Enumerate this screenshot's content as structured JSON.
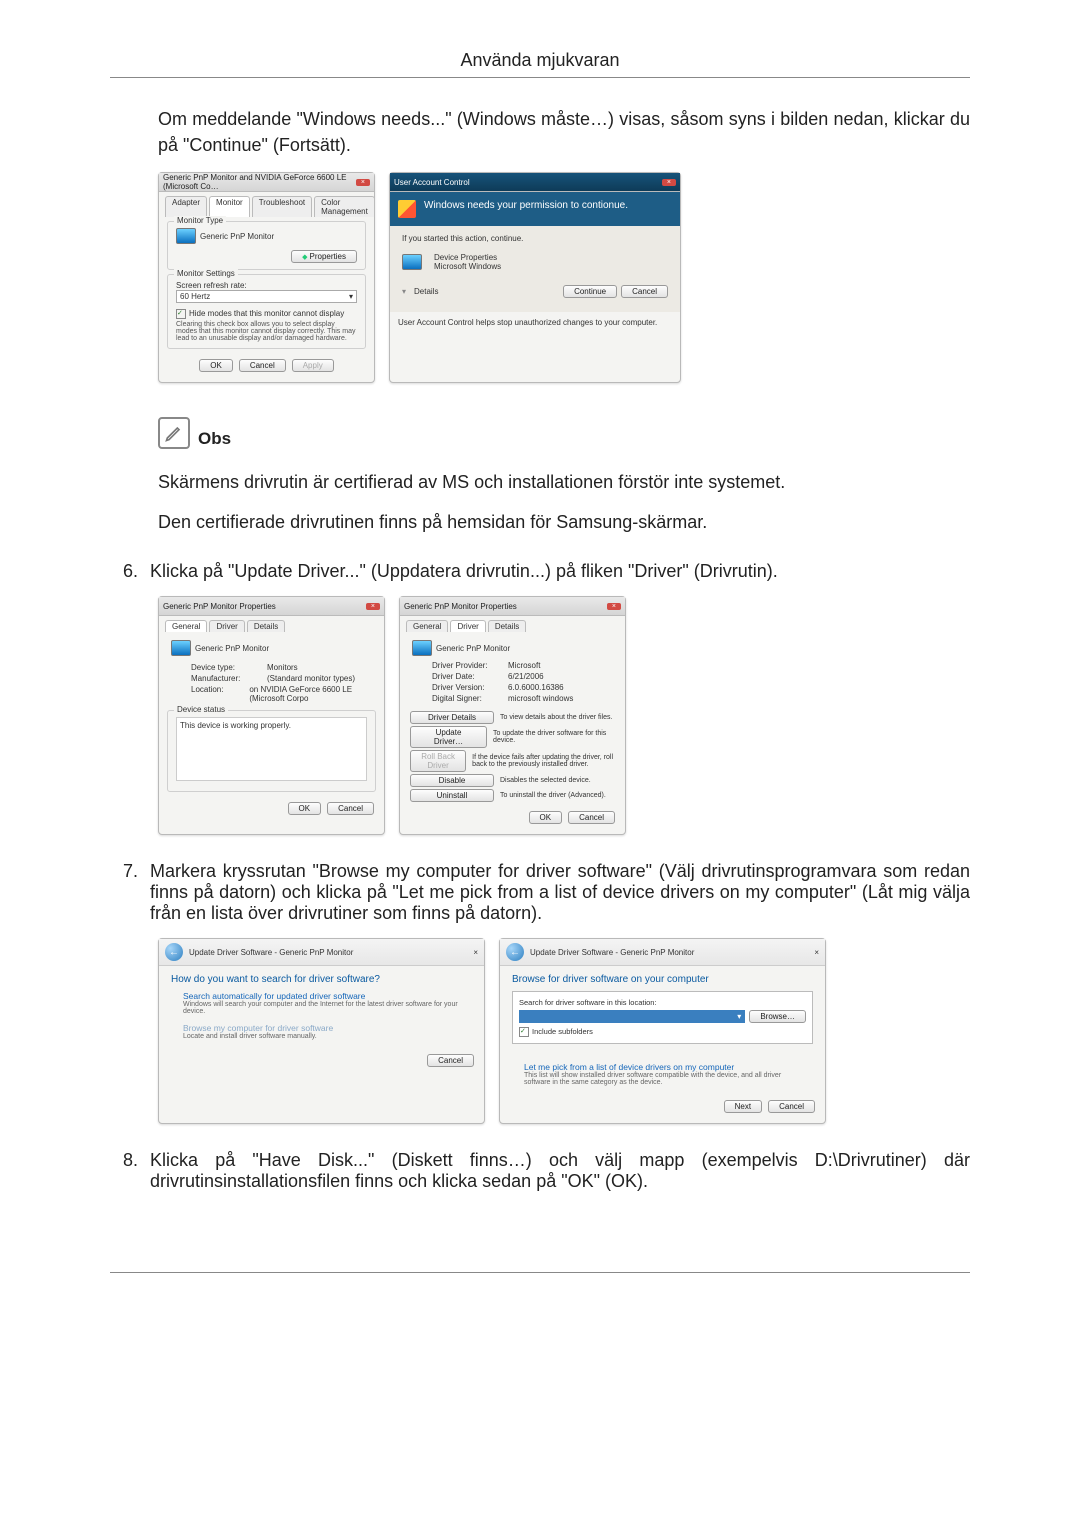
{
  "section_title": "Använda mjukvaran",
  "intro": "Om meddelande \"Windows needs...\" (Windows måste…) visas, såsom syns i bilden nedan, klickar du på \"Continue\" (Fortsätt).",
  "note_label": "Obs",
  "note_p1": "Skärmens drivrutin är certifierad av MS och installationen förstör inte systemet.",
  "note_p2": "Den certifierade drivrutinen finns på hemsidan för Samsung-skärmar.",
  "step6_num": "6.",
  "step6": "Klicka på \"Update Driver...\" (Uppdatera drivrutin...) på fliken \"Driver\" (Drivrutin).",
  "step7_num": "7.",
  "step7": "Markera kryssrutan \"Browse my computer for driver software\" (Välj drivrutinsprogramvara som redan finns på datorn) och klicka på \"Let me pick from a list of device drivers on my computer\" (Låt mig välja från en lista över drivrutiner som finns på datorn).",
  "step8_num": "8.",
  "step8": "Klicka på \"Have Disk...\" (Diskett finns…) och välj mapp (exempelvis D:\\Drivrutiner) där drivrutinsinstallationsfilen finns och klicka sedan på \"OK\" (OK).",
  "dlg1": {
    "title": "Generic PnP Monitor and NVIDIA GeForce 6600 LE (Microsoft Co…",
    "tabs": {
      "adapter": "Adapter",
      "monitor": "Monitor",
      "troubleshoot": "Troubleshoot",
      "color": "Color Management"
    },
    "monitor_type": "Monitor Type",
    "monitor_name": "Generic PnP Monitor",
    "properties": "Properties",
    "monitor_settings": "Monitor Settings",
    "refresh_label": "Screen refresh rate:",
    "refresh_value": "60 Hertz",
    "hide_cb": "Hide modes that this monitor cannot display",
    "hide_desc": "Clearing this check box allows you to select display modes that this monitor cannot display correctly. This may lead to an unusable display and/or damaged hardware.",
    "ok": "OK",
    "cancel": "Cancel",
    "apply": "Apply"
  },
  "uac": {
    "title": "User Account Control",
    "headline": "Windows needs your permission to contionue.",
    "if_started": "If you started this action, continue.",
    "prop": "Device Properties",
    "vendor": "Microsoft Windows",
    "details": "Details",
    "continue": "Continue",
    "cancel": "Cancel",
    "footer": "User Account Control helps stop unauthorized changes to your computer."
  },
  "propsL": {
    "title": "Generic PnP Monitor Properties",
    "tabs": {
      "general": "General",
      "driver": "Driver",
      "details": "Details"
    },
    "monitor_name": "Generic PnP Monitor",
    "device_type_k": "Device type:",
    "device_type_v": "Monitors",
    "manufacturer_k": "Manufacturer:",
    "manufacturer_v": "(Standard monitor types)",
    "location_k": "Location:",
    "location_v": "on NVIDIA GeForce 6600 LE (Microsoft Corpo",
    "status_legend": "Device status",
    "status_text": "This device is working properly.",
    "ok": "OK",
    "cancel": "Cancel"
  },
  "propsR": {
    "title": "Generic PnP Monitor Properties",
    "tabs": {
      "general": "General",
      "driver": "Driver",
      "details": "Details"
    },
    "monitor_name": "Generic PnP Monitor",
    "provider_k": "Driver Provider:",
    "provider_v": "Microsoft",
    "date_k": "Driver Date:",
    "date_v": "6/21/2006",
    "version_k": "Driver Version:",
    "version_v": "6.0.6000.16386",
    "signer_k": "Digital Signer:",
    "signer_v": "microsoft windows",
    "btn_details": "Driver Details",
    "btn_details_d": "To view details about the driver files.",
    "btn_update": "Update Driver…",
    "btn_update_d": "To update the driver software for this device.",
    "btn_rollback": "Roll Back Driver",
    "btn_rollback_d": "If the device fails after updating the driver, roll back to the previously installed driver.",
    "btn_disable": "Disable",
    "btn_disable_d": "Disables the selected device.",
    "btn_uninstall": "Uninstall",
    "btn_uninstall_d": "To uninstall the driver (Advanced).",
    "ok": "OK",
    "cancel": "Cancel"
  },
  "wizL": {
    "breadcrumb": "Update Driver Software - Generic PnP Monitor",
    "heading": "How do you want to search for driver software?",
    "opt1_t": "Search automatically for updated driver software",
    "opt1_d": "Windows will search your computer and the Internet for the latest driver software for your device.",
    "opt2_t": "Browse my computer for driver software",
    "opt2_d": "Locate and install driver software manually.",
    "cancel": "Cancel"
  },
  "wizR": {
    "breadcrumb": "Update Driver Software - Generic PnP Monitor",
    "heading": "Browse for driver software on your computer",
    "search_label": "Search for driver software in this location:",
    "browse": "Browse…",
    "include_sub": "Include subfolders",
    "opt_t": "Let me pick from a list of device drivers on my computer",
    "opt_d": "This list will show installed driver software compatible with the device, and all driver software in the same category as the device.",
    "next": "Next",
    "cancel": "Cancel"
  }
}
